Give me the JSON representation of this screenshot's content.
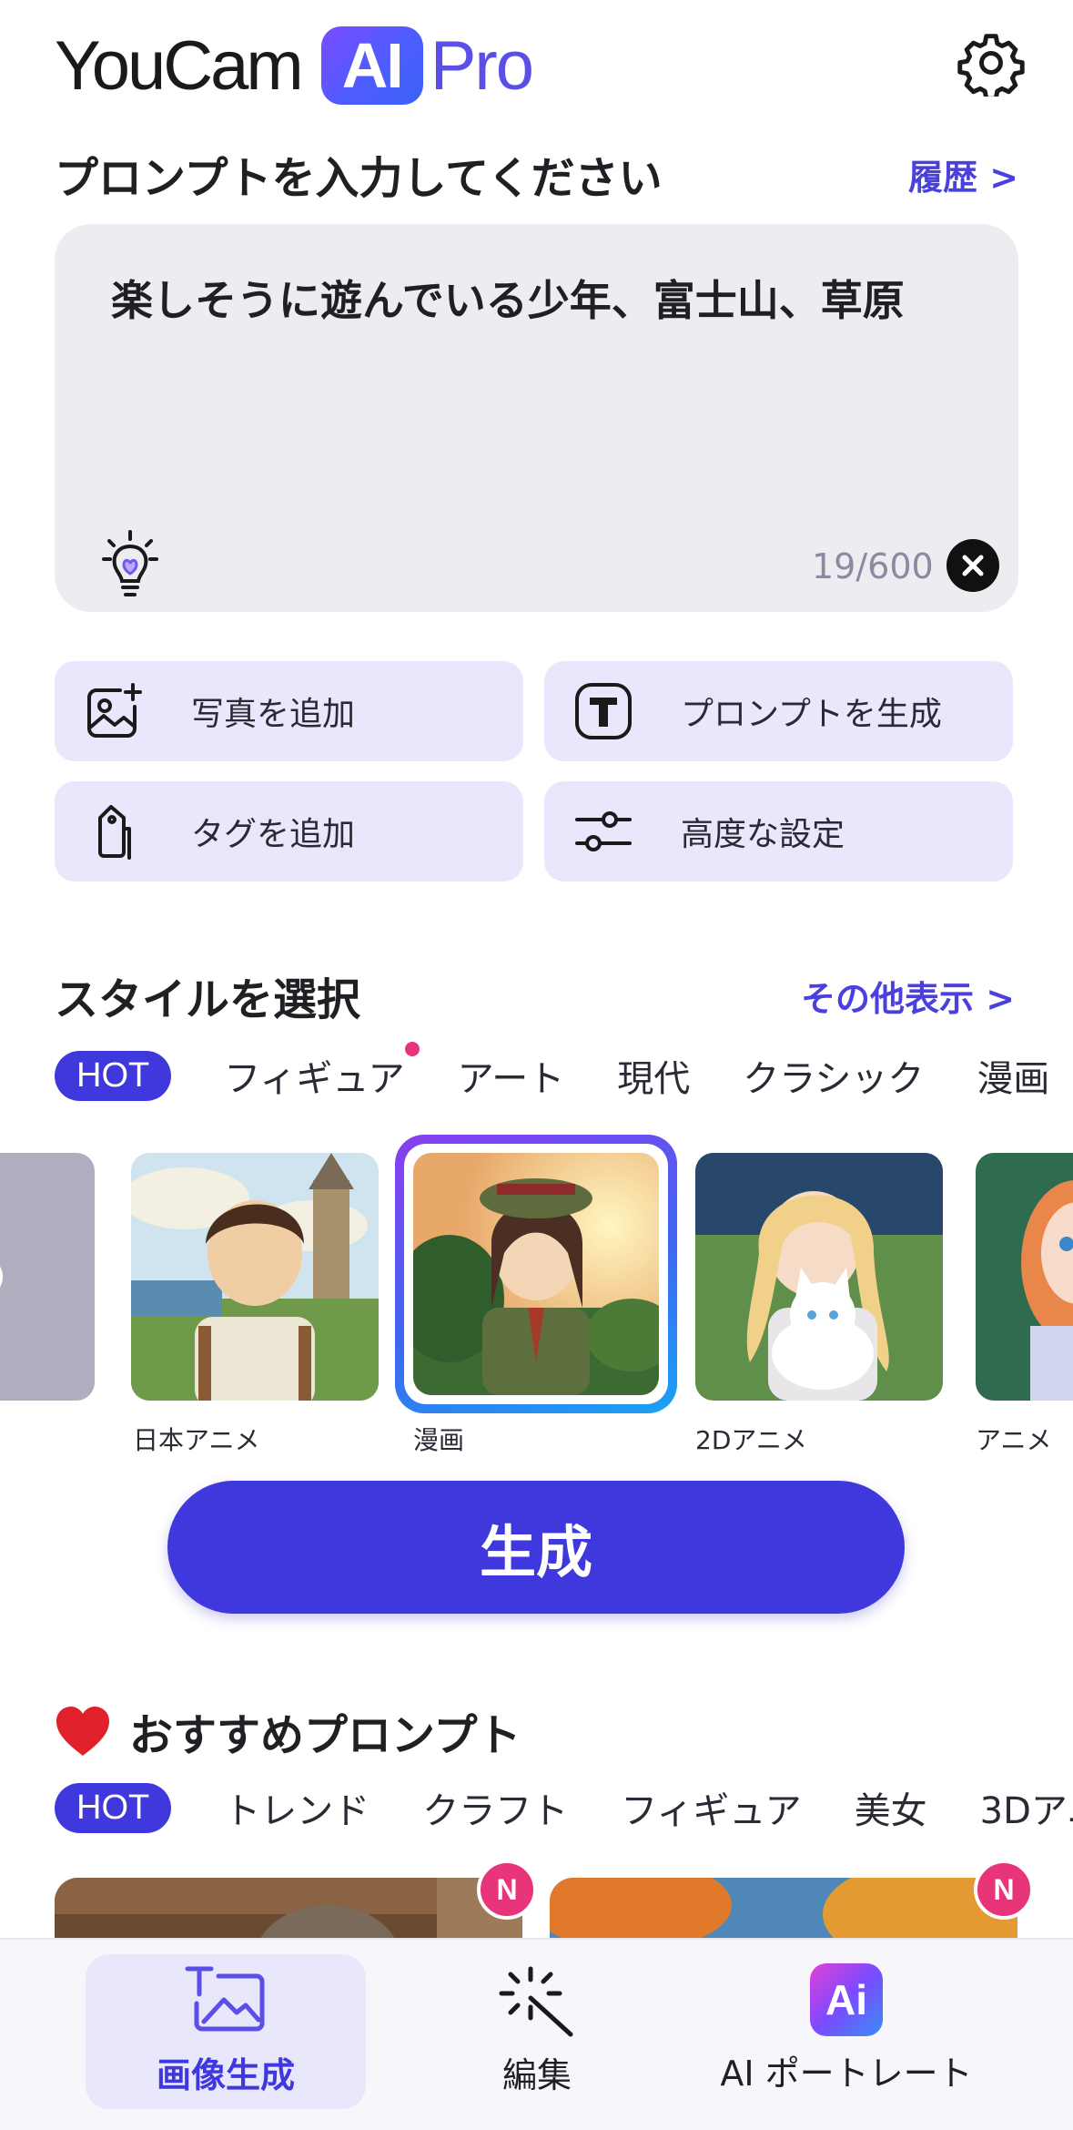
{
  "header": {
    "logo_word": "YouCam",
    "logo_ai": "AI",
    "logo_pro": "Pro"
  },
  "prompt": {
    "heading": "プロンプトを入力してください",
    "history_link": "履歴 >",
    "text": "楽しそうに遊んでいる少年、富士山、草原",
    "counter": "19/600"
  },
  "actions": {
    "add_photo": "写真を追加",
    "generate_prompt": "プロンプトを生成",
    "add_tag": "タグを追加",
    "advanced": "高度な設定"
  },
  "styles": {
    "heading": "スタイルを選択",
    "more_link": "その他表示 >",
    "tabs": [
      "HOT",
      "フィギュア",
      "アート",
      "現代",
      "クラシック",
      "漫画"
    ],
    "items": [
      "日本アニメ",
      "漫画",
      "2Dアニメ",
      "アニメ"
    ],
    "selected": "漫画"
  },
  "generate_button": "生成",
  "recommended": {
    "heading": "おすすめプロンプト",
    "tabs": [
      "HOT",
      "トレンド",
      "クラフト",
      "フィギュア",
      "美女",
      "3Dアニ"
    ],
    "badge": "N"
  },
  "bottom_nav": {
    "items": [
      "画像生成",
      "編集",
      "AI ポートレート"
    ],
    "active": "画像生成",
    "ai_icon_text": "Ai"
  },
  "colors": {
    "accent": "#3f38dc",
    "link": "#4a40de",
    "badge": "#e8357a"
  }
}
